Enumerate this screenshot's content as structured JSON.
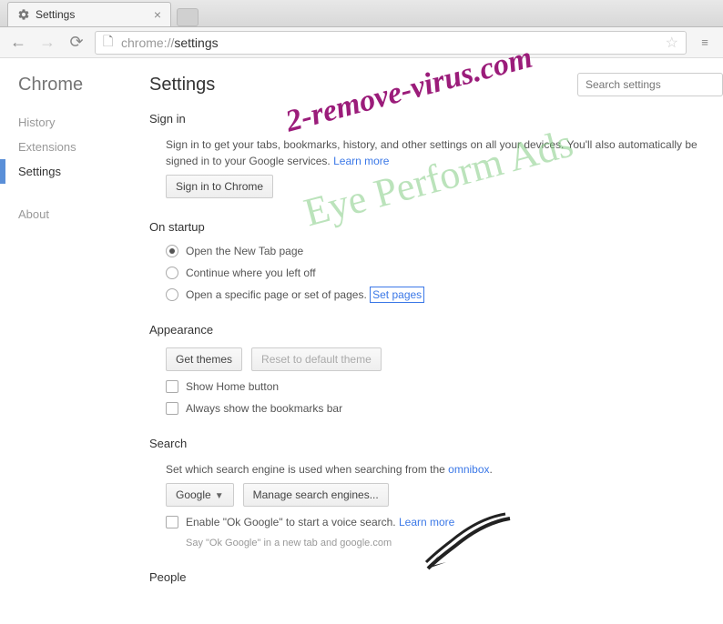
{
  "tab": {
    "title": "Settings"
  },
  "toolbar": {
    "url_prefix": "chrome://",
    "url_path": "settings"
  },
  "sidebar": {
    "brand": "Chrome",
    "items": [
      {
        "label": "History",
        "active": false
      },
      {
        "label": "Extensions",
        "active": false
      },
      {
        "label": "Settings",
        "active": true
      },
      {
        "label": "About",
        "active": false
      }
    ]
  },
  "search_placeholder": "Search settings",
  "page_title": "Settings",
  "signin": {
    "title": "Sign in",
    "desc_a": "Sign in to get your tabs, bookmarks, history, and other settings on all your devices. You'll also automatically be signed in to your Google services. ",
    "learn_more": "Learn more",
    "button": "Sign in to Chrome"
  },
  "startup": {
    "title": "On startup",
    "opt1": "Open the New Tab page",
    "opt2": "Continue where you left off",
    "opt3": "Open a specific page or set of pages. ",
    "set_pages": "Set pages"
  },
  "appearance": {
    "title": "Appearance",
    "get_themes": "Get themes",
    "reset_theme": "Reset to default theme",
    "show_home": "Show Home button",
    "show_bookmarks": "Always show the bookmarks bar"
  },
  "search": {
    "title": "Search",
    "desc": "Set which search engine is used when searching from the ",
    "omnibox_link": "omnibox",
    "engine_btn": "Google",
    "manage_btn": "Manage search engines...",
    "ok_google": "Enable \"Ok Google\" to start a voice search. ",
    "learn_more": "Learn more",
    "hint": "Say \"Ok Google\" in a new tab and google.com"
  },
  "people": {
    "title": "People"
  },
  "watermark1": "2-remove-virus.com",
  "watermark2": "Eye Perform Ads"
}
